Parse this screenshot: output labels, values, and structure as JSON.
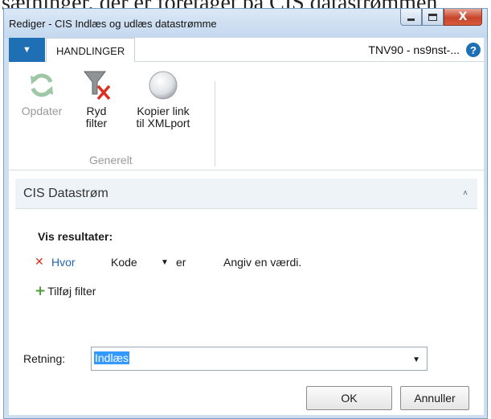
{
  "background_text": "sætninger, der er foretaget på CIS datastrømmen",
  "window": {
    "title": "Rediger - CIS Indlæs og udlæs datastrømme",
    "controls": {
      "close": "X"
    }
  },
  "ribbon": {
    "app_menu_glyph": "▼",
    "tab": "HANDLINGER",
    "context": "TNV90 - ns9nst-...",
    "help_glyph": "?",
    "buttons": [
      {
        "label_1": "Opdater",
        "label_2": "",
        "icon": "refresh-icon",
        "enabled": false
      },
      {
        "label_1": "Ryd",
        "label_2": "filter",
        "icon": "clear-filter-icon",
        "enabled": true
      },
      {
        "label_1": "Kopier link",
        "label_2": "til XMLport",
        "icon": "copy-link-icon",
        "enabled": true
      }
    ],
    "group_label": "Generelt"
  },
  "fasttab": {
    "title": "CIS Datastrøm",
    "chevron": "˄"
  },
  "filter": {
    "heading": "Vis resultater:",
    "remove_glyph": "✕",
    "where": "Hvor",
    "field": "Kode",
    "dropdown_glyph": "▼",
    "operator": "er",
    "placeholder": "Angiv en værdi.",
    "add_glyph": "+",
    "add_label": "Tilføj filter"
  },
  "direction": {
    "label": "Retning:",
    "value": "Indlæs",
    "dropdown_glyph": "▼"
  },
  "buttons": {
    "ok": "OK",
    "cancel": "Annuller"
  }
}
